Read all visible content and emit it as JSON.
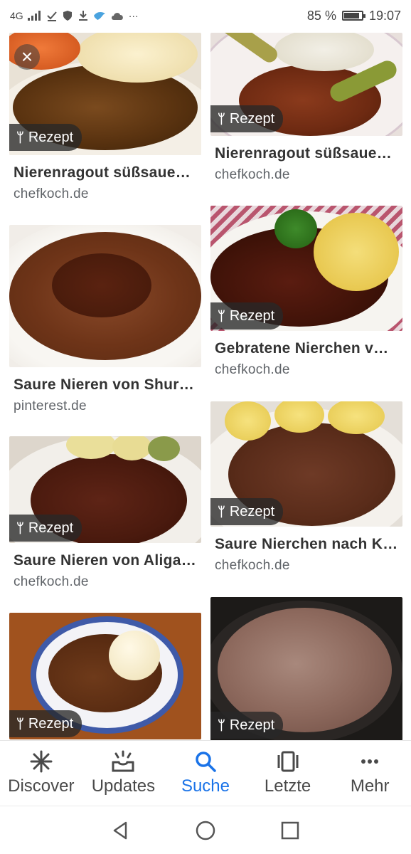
{
  "status": {
    "network": "4G",
    "battery": "85 %",
    "time": "19:07",
    "more": "···"
  },
  "results": [
    {
      "badge": "Rezept",
      "title": "Nierenragout süßsaue…",
      "source": "chefkoch.de"
    },
    {
      "badge": "Rezept",
      "title": "Nierenragout süßsaue…",
      "source": "chefkoch.de"
    },
    {
      "title": "Saure Nieren von Shur…",
      "source": "pinterest.de"
    },
    {
      "badge": "Rezept",
      "title": "Gebratene Nierchen v…",
      "source": "chefkoch.de"
    },
    {
      "badge": "Rezept",
      "title": "Saure Nieren von Aliga…",
      "source": "chefkoch.de"
    },
    {
      "badge": "Rezept",
      "title": "Saure Nierchen nach K…",
      "source": "chefkoch.de"
    },
    {
      "badge": "Rezept"
    },
    {
      "badge": "Rezept"
    }
  ],
  "bottom_nav": [
    {
      "label": "Discover",
      "icon": "asterisk-icon"
    },
    {
      "label": "Updates",
      "icon": "inbox-icon"
    },
    {
      "label": "Suche",
      "icon": "search-icon"
    },
    {
      "label": "Letzte",
      "icon": "recent-tabs-icon"
    },
    {
      "label": "Mehr",
      "icon": "more-horiz-icon"
    }
  ],
  "colors": {
    "accent": "#1a73e8",
    "badge_bg": "#282828"
  }
}
